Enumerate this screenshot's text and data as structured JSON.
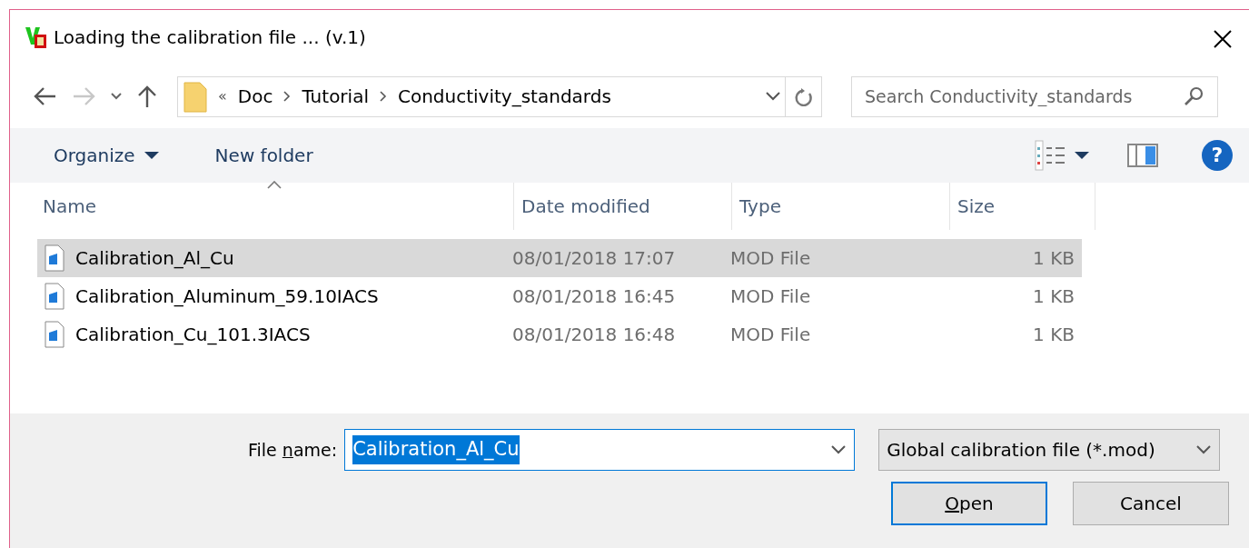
{
  "window": {
    "title": "Loading the calibration file ... (v.1)"
  },
  "navigation": {
    "back_enabled": true,
    "forward_enabled": false
  },
  "address_bar": {
    "overflow": "«",
    "crumbs": [
      "Doc",
      "Tutorial",
      "Conductivity_standards"
    ]
  },
  "search": {
    "placeholder": "Search Conductivity_standards"
  },
  "toolbar": {
    "organize": "Organize",
    "new_folder": "New folder",
    "help": "?"
  },
  "table": {
    "columns": [
      {
        "label": "Name",
        "sorted": true
      },
      {
        "label": "Date modified",
        "sorted": false
      },
      {
        "label": "Type",
        "sorted": false
      },
      {
        "label": "Size",
        "sorted": false
      }
    ],
    "rows": [
      {
        "cells": [
          "Calibration_Al_Cu",
          "08/01/2018 17:07",
          "MOD File",
          "1 KB"
        ],
        "selected": true
      },
      {
        "cells": [
          "Calibration_Aluminum_59.10IACS",
          "08/01/2018 16:45",
          "MOD File",
          "1 KB"
        ],
        "selected": false
      },
      {
        "cells": [
          "Calibration_Cu_101.3IACS",
          "08/01/2018 16:48",
          "MOD File",
          "1 KB"
        ],
        "selected": false
      }
    ]
  },
  "file_name": {
    "label": [
      {
        "text": "File ",
        "mnemonic": false
      },
      {
        "text": "n",
        "mnemonic": true
      },
      {
        "text": "ame:",
        "mnemonic": false
      }
    ],
    "value": "Calibration_Al_Cu",
    "text_selected": true
  },
  "filter": {
    "value": "Global calibration file (*.mod)"
  },
  "buttons": [
    {
      "label": [
        {
          "text": "O",
          "mnemonic": true
        },
        {
          "text": "pen",
          "mnemonic": false
        }
      ],
      "default": true
    },
    {
      "label": [
        {
          "text": "Cancel",
          "mnemonic": false
        }
      ],
      "default": false
    }
  ]
}
